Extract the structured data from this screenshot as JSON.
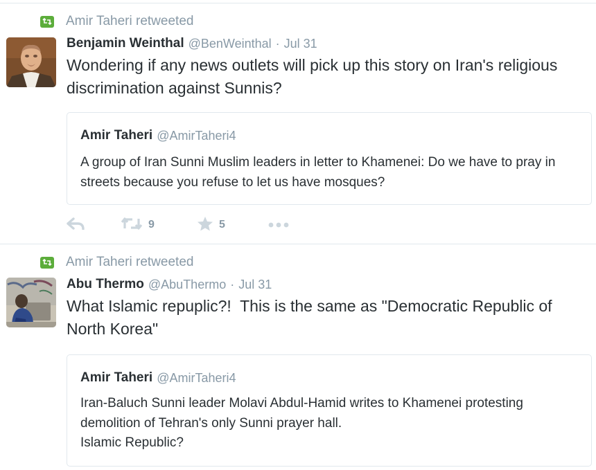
{
  "tweets": [
    {
      "retweeted_by": "Amir Taheri retweeted",
      "author_name": "Benjamin Weinthal",
      "author_handle": "@BenWeinthal",
      "separator": "·",
      "date": "Jul 31",
      "text": "Wondering if any news outlets will pick up this story on Iran's religious discrimination against Sunnis?",
      "quote": {
        "author_name": "Amir Taheri",
        "author_handle": "@AmirTaheri4",
        "text": "A group of Iran Sunni Muslim leaders in letter to Khamenei: Do we have to pray in streets because you refuse to let us have mosques?"
      },
      "actions": {
        "retweet_count": "9",
        "favorite_count": "5"
      }
    },
    {
      "retweeted_by": "Amir Taheri retweeted",
      "author_name": "Abu Thermo",
      "author_handle": "@AbuThermo",
      "separator": "·",
      "date": "Jul 31",
      "text": "What Islamic repuplic?!  This is the same as \"Democratic Republic of North Korea\"",
      "quote": {
        "author_name": "Amir Taheri",
        "author_handle": "@AmirTaheri4",
        "text_line1": "Iran-Baluch Sunni leader Molavi Abdul-Hamid writes to Khamenei protesting demolition of Tehran's only Sunni prayer hall.",
        "text_line2": "Islamic Republic?"
      }
    }
  ],
  "icons": [
    "retweet-badge-icon",
    "reply-icon",
    "retweet-icon",
    "favorite-star-icon",
    "more-dots-icon"
  ],
  "colors": {
    "retweet_green": "#5cad3b",
    "muted_gray": "#8899a6",
    "text": "#292f33",
    "border": "#e1e8ed",
    "action_icon": "#ccd6dd"
  }
}
